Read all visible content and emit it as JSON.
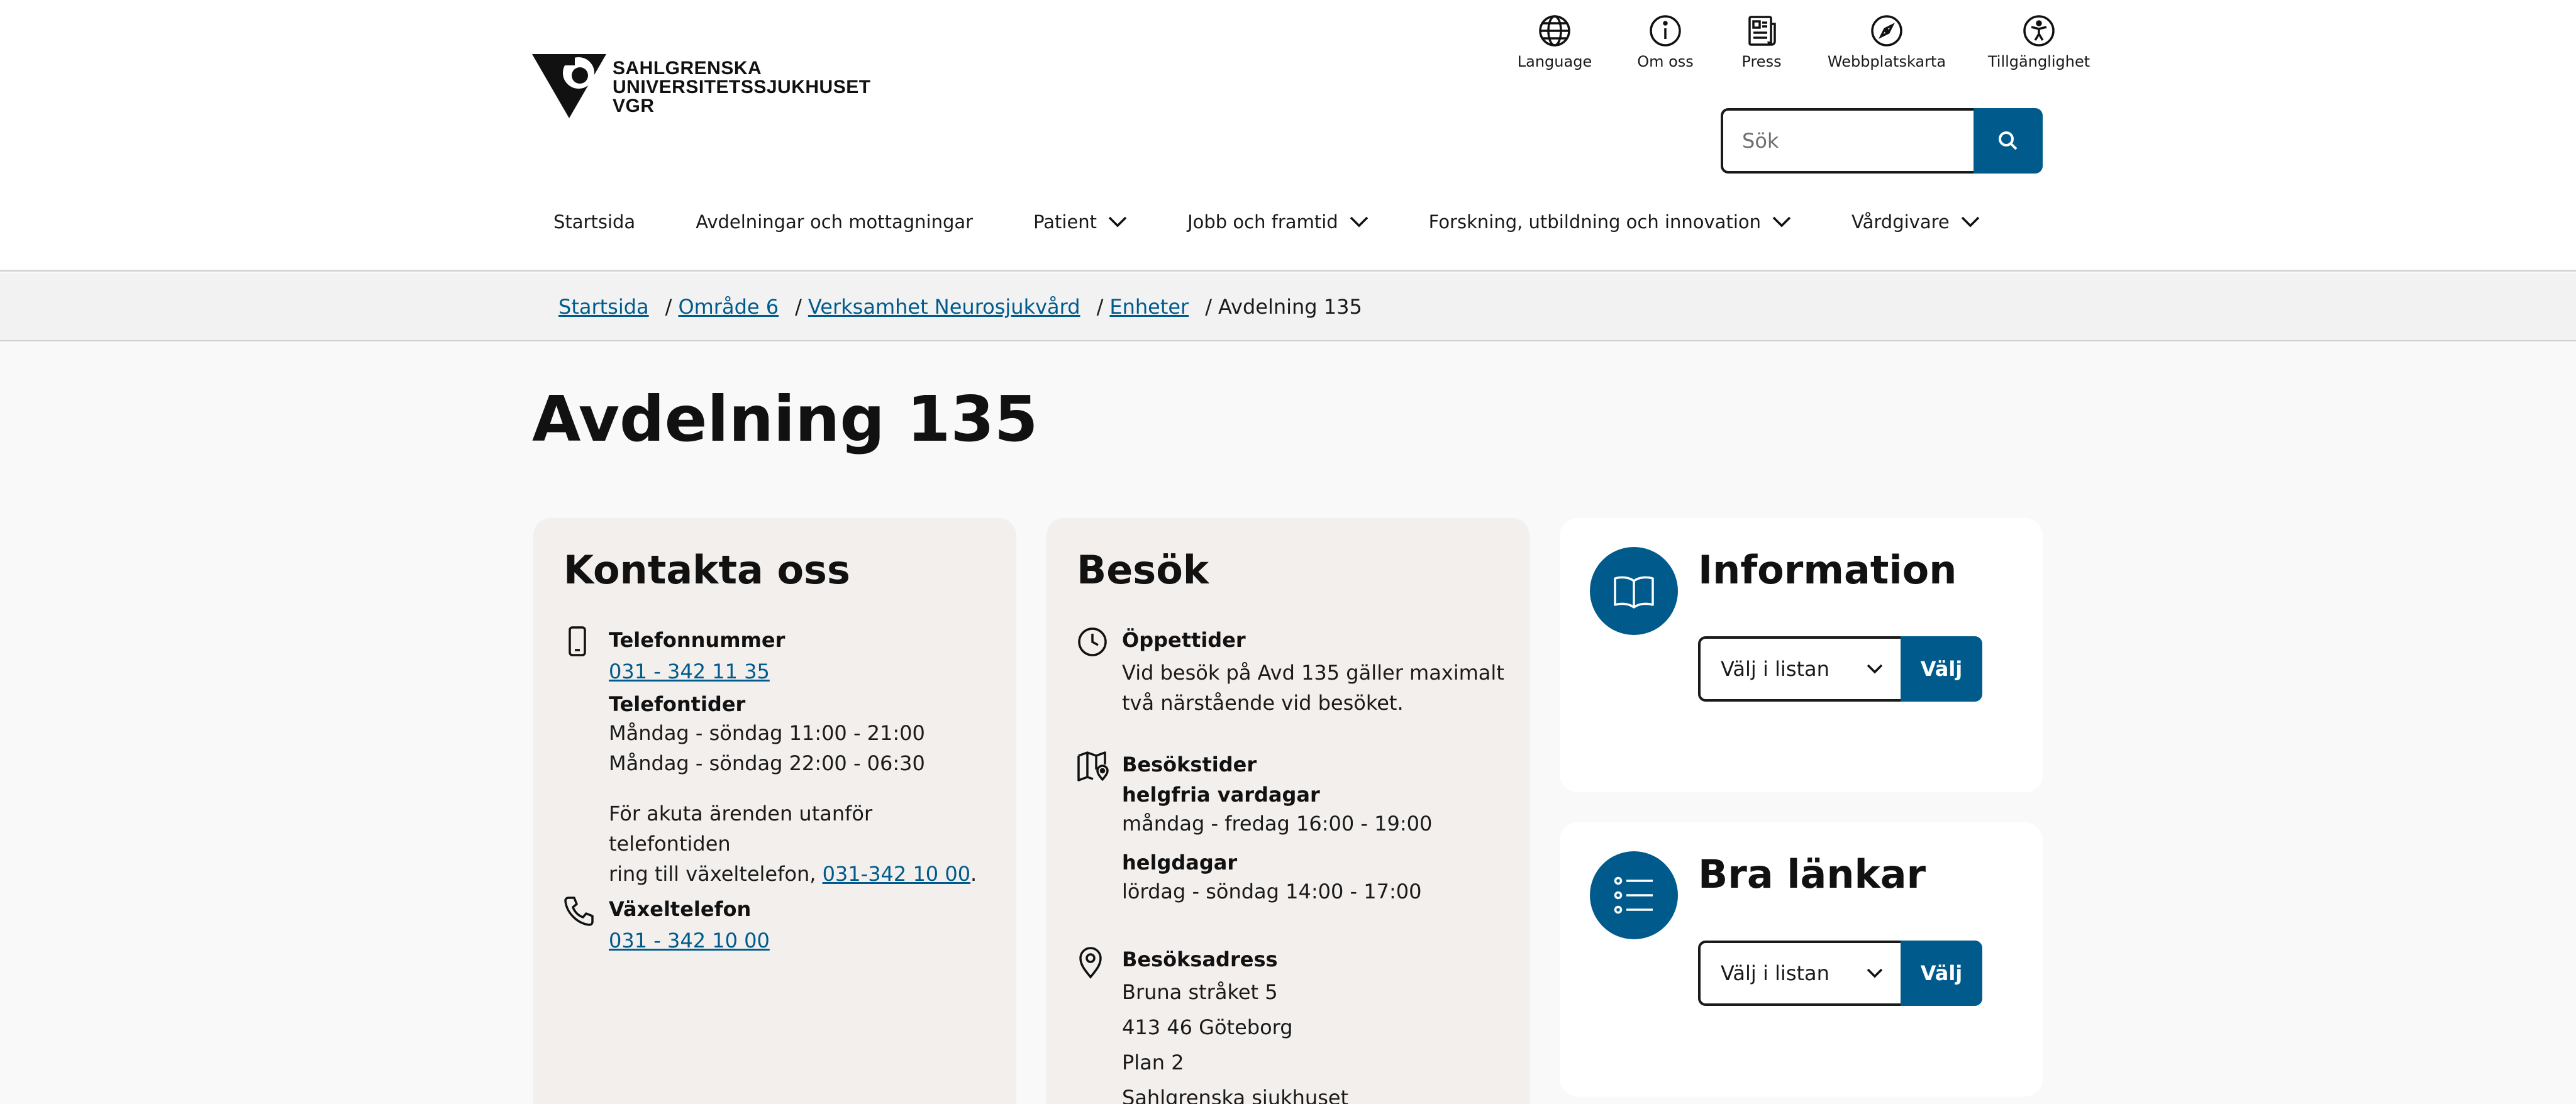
{
  "logo": {
    "line1": "SAHLGRENSKA",
    "line2": "UNIVERSITETSSJUKHUSET",
    "line3": "VGR"
  },
  "utility": {
    "language": "Language",
    "about": "Om oss",
    "press": "Press",
    "sitemap": "Webbplatskarta",
    "accessibility": "Tillgänglighet"
  },
  "search": {
    "placeholder": "Sök"
  },
  "nav": {
    "start": "Startsida",
    "departments": "Avdelningar och mottagningar",
    "patient": "Patient",
    "jobs": "Jobb och framtid",
    "research": "Forskning, utbildning och innovation",
    "caregivers": "Vårdgivare"
  },
  "breadcrumb": {
    "items": [
      "Startsida",
      "Område 6",
      "Verksamhet Neurosjukvård",
      "Enheter"
    ],
    "current": "Avdelning 135"
  },
  "page": {
    "title": "Avdelning 135"
  },
  "contact": {
    "title": "Kontakta oss",
    "phone_label": "Telefonnummer",
    "phone_number": "031 - 342 11 35",
    "hours_label": "Telefontider",
    "hours_1": "Måndag - söndag 11:00 - 21:00",
    "hours_2": "Måndag - söndag 22:00 - 06:30",
    "urgent_line1": "För akuta ärenden utanför telefontiden",
    "urgent_line2": "ring till växeltelefon,",
    "urgent_number": "031-342 10 00",
    "urgent_end": ".",
    "switchboard_label": "Växeltelefon",
    "switchboard_number": "031 - 342 10 00"
  },
  "visit": {
    "title": "Besök",
    "open_label": "Öppettider",
    "open_line1": "Vid besök på Avd 135 gäller maximalt",
    "open_line2": "två närstående vid besöket.",
    "visiting_label": "Besökstider",
    "weekday_label": "helgfria vardagar",
    "weekday_time": "måndag - fredag 16:00 - 19:00",
    "holiday_label": "helgdagar",
    "holiday_time": "lördag - söndag 14:00 - 17:00",
    "address_label": "Besöksadress",
    "address_1": "Bruna stråket 5",
    "address_2": "413 46 Göteborg",
    "address_3": "Plan 2",
    "address_4": "Sahlgrenska sjukhuset"
  },
  "information": {
    "title": "Information",
    "select_value": "Välj i listan",
    "button": "Välj"
  },
  "links": {
    "title": "Bra länkar",
    "select_value": "Välj i listan",
    "button": "Välj"
  },
  "colors": {
    "brand_blue": "#005b8c",
    "card_beige": "#f2efed",
    "background": "#f9f9f9"
  }
}
